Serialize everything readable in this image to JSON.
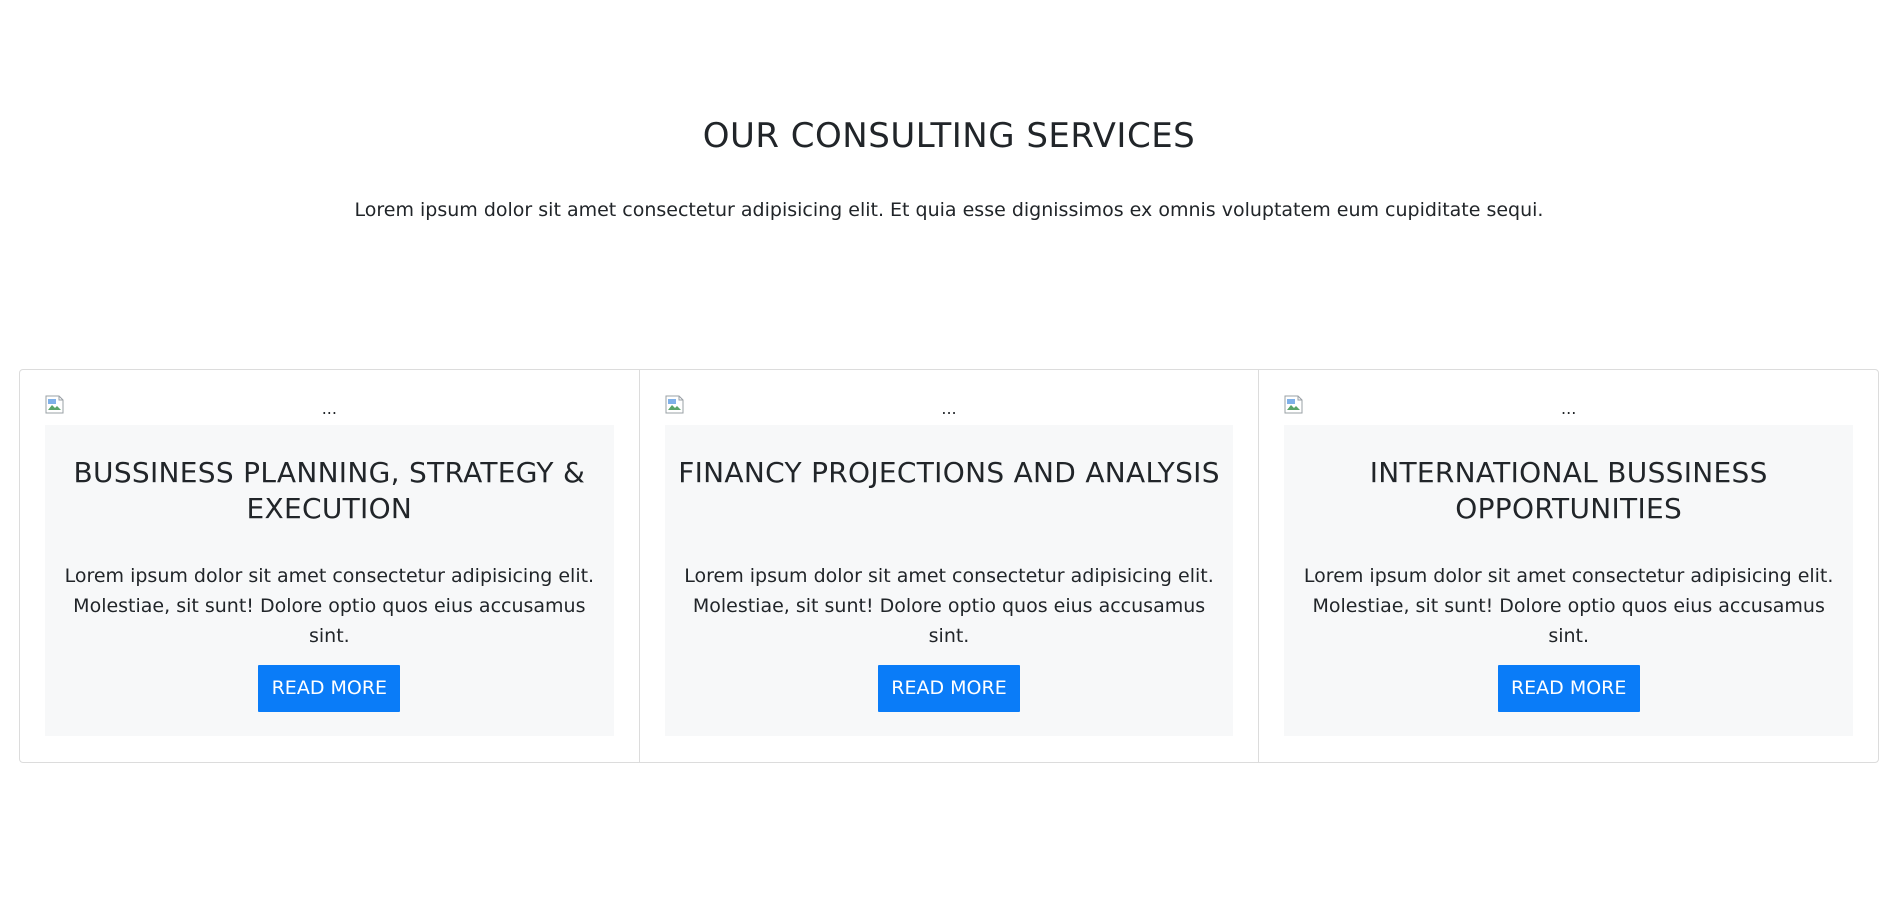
{
  "section": {
    "title": "OUR CONSULTING SERVICES",
    "subtitle": "Lorem ipsum dolor sit amet consectetur adipisicing elit. Et quia esse dignissimos ex omnis voluptatem eum cupiditate sequi."
  },
  "cards": [
    {
      "image_alt": "...",
      "title": "BUSSINESS PLANNING, STRATEGY & EXECUTION",
      "text": "Lorem ipsum dolor sit amet consectetur adipisicing elit. Molestiae, sit sunt! Dolore optio quos eius accusamus sint.",
      "button_label": "READ MORE"
    },
    {
      "image_alt": "...",
      "title": "FINANCY PROJECTIONS AND ANALYSIS",
      "text": "Lorem ipsum dolor sit amet consectetur adipisicing elit. Molestiae, sit sunt! Dolore optio quos eius accusamus sint.",
      "button_label": "READ MORE"
    },
    {
      "image_alt": "...",
      "title": "INTERNATIONAL BUSSINESS OPPORTUNITIES",
      "text": "Lorem ipsum dolor sit amet consectetur adipisicing elit. Molestiae, sit sunt! Dolore optio quos eius accusamus sint.",
      "button_label": "READ MORE"
    }
  ],
  "colors": {
    "button_bg": "#0a7cf8",
    "card_body_bg": "#f7f8f9",
    "border": "#dcdcdc"
  },
  "icons": {
    "image_placeholder": "broken-image-icon"
  }
}
